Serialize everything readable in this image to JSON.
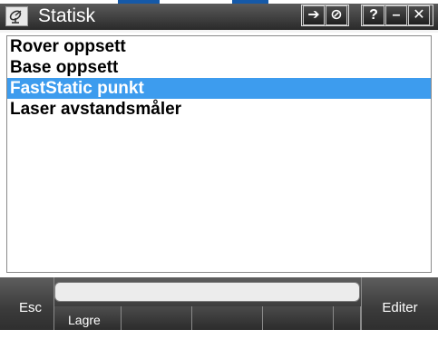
{
  "window": {
    "title": "Statisk",
    "app_icon": "satellite-dish-icon",
    "buttons": [
      {
        "name": "connect-icon",
        "glyph": "➔"
      },
      {
        "name": "no-entry-icon",
        "glyph": "⊘"
      },
      {
        "name": "help-icon",
        "glyph": "?"
      },
      {
        "name": "minimize-icon",
        "glyph": "–"
      },
      {
        "name": "close-icon",
        "glyph": "✕"
      }
    ]
  },
  "list": {
    "items": [
      {
        "label": "Rover oppsett",
        "selected": false
      },
      {
        "label": "Base oppsett",
        "selected": false
      },
      {
        "label": "FastStatic punkt",
        "selected": true
      },
      {
        "label": "Laser avstandsmåler",
        "selected": false
      }
    ]
  },
  "softkeys": {
    "esc_label": "Esc",
    "lagre_label": "Lagre",
    "editer_label": "Editer"
  },
  "colors": {
    "selection": "#3d9cee",
    "titlebar": "#2a2a2a",
    "softkey_bar": "#3b3b3b"
  }
}
